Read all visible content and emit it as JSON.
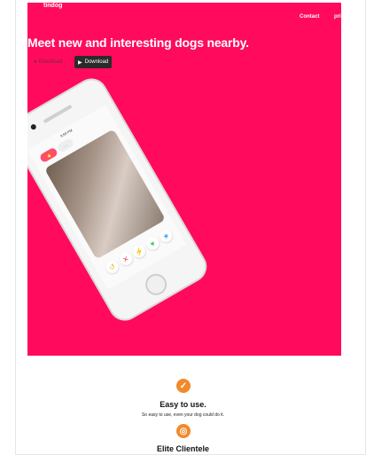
{
  "nav": {
    "brand": "tindog",
    "contact": "Contact",
    "pricing": "pri"
  },
  "hero": {
    "headline": "Meet new and interesting dogs nearby.",
    "background": "#ff0a5c",
    "buttons": {
      "ios_label": "Download",
      "play_label": "Download"
    },
    "phone": {
      "time": "9:59 PM"
    }
  },
  "features": [
    {
      "icon": "check-circle-icon",
      "title": "Easy to use.",
      "description": "So easy to use, even your dog could do it."
    },
    {
      "icon": "bullseye-icon",
      "title": "Elite Clientele",
      "description": ""
    }
  ]
}
